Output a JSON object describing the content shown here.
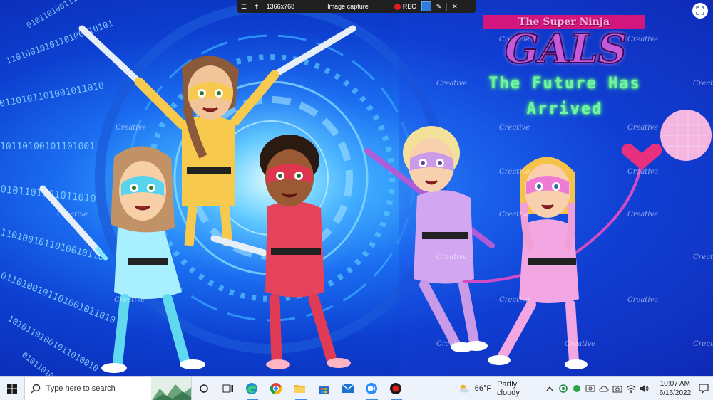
{
  "capture_bar": {
    "resolution_label": "1366x768",
    "mode_label": "Image capture",
    "rec_label": "REC"
  },
  "title": {
    "line1": "The Super Ninja",
    "line2": "GALS",
    "line3": "The Future Has",
    "line4": "Arrived"
  },
  "watermark": {
    "text": "Creative"
  },
  "taskbar": {
    "search_placeholder": "Type here to search",
    "pinned_icons": [
      "task-view-icon",
      "edge-icon",
      "chrome-icon",
      "file-explorer-icon",
      "microsoft-store-icon",
      "mail-icon",
      "zoom-icon",
      "record-icon"
    ],
    "weather": {
      "temp": "66°F",
      "condition": "Partly cloudy"
    },
    "tray_icons": [
      "chevron-up-icon",
      "green-circle-icon",
      "green-dot-icon",
      "network-icon",
      "onedrive-icon",
      "camera-icon",
      "wifi-icon",
      "volume-icon"
    ],
    "clock": {
      "time": "10:07 AM",
      "date": "6/16/2022"
    }
  },
  "colors": {
    "scene_glow": "#3fb0ff",
    "scene_deep": "#0a23a8",
    "title_pink": "#d3157e",
    "title_purple": "#c65bd9",
    "title_green": "#6ef5a8",
    "taskbar_bg": "#eef3fb",
    "rec_red": "#e31b1b"
  }
}
